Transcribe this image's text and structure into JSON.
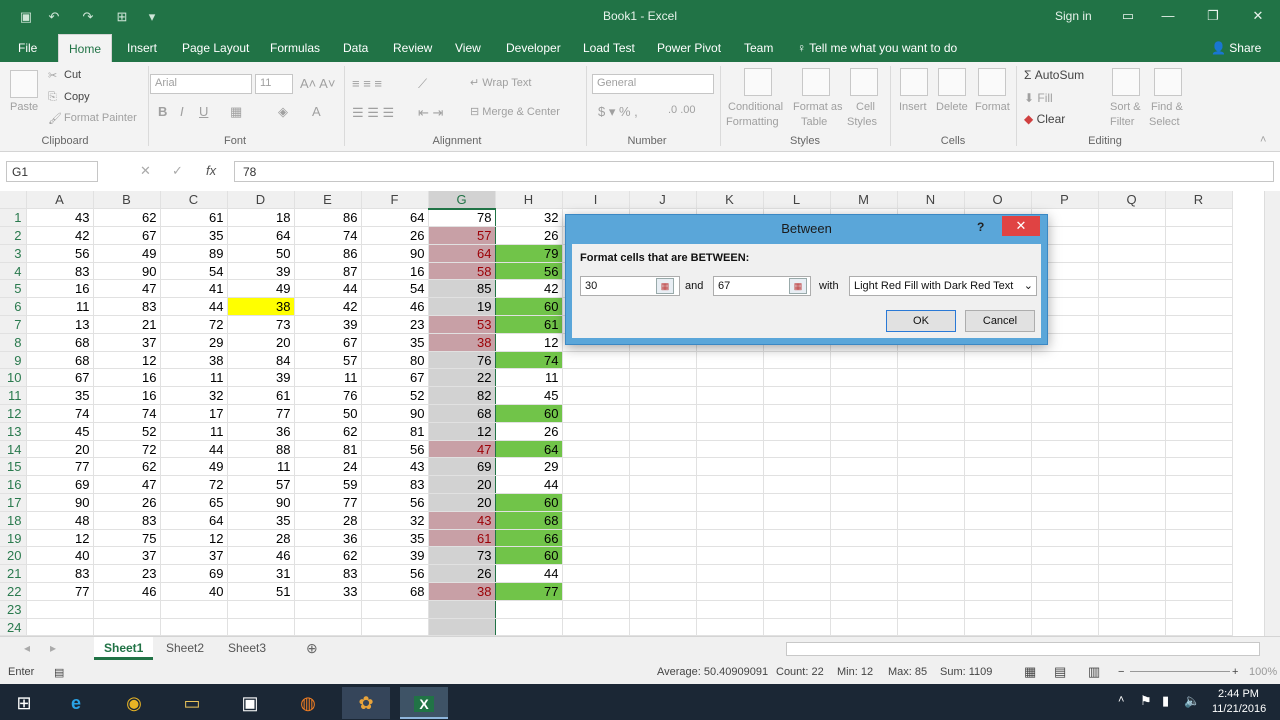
{
  "window": {
    "title": "Book1 - Excel",
    "sign_in": "Sign in"
  },
  "menu": {
    "tabs": [
      "File",
      "Home",
      "Insert",
      "Page Layout",
      "Formulas",
      "Data",
      "Review",
      "View",
      "Developer",
      "Load Test",
      "Power Pivot",
      "Team"
    ],
    "tell_me": "Tell me what you want to do",
    "share": "Share"
  },
  "ribbon": {
    "clipboard": {
      "paste": "Paste",
      "cut": "Cut",
      "copy": "Copy",
      "format_painter": "Format Painter",
      "label": "Clipboard"
    },
    "font": {
      "name": "Arial",
      "size": "11",
      "label": "Font"
    },
    "alignment": {
      "wrap_text": "Wrap Text",
      "merge_center": "Merge & Center",
      "label": "Alignment"
    },
    "number": {
      "format": "General",
      "label": "Number"
    },
    "styles": {
      "conditional": "Conditional",
      "formatting": "Formatting",
      "format_as": "Format as",
      "table": "Table",
      "cell": "Cell",
      "cell_styles": "Styles",
      "label": "Styles"
    },
    "cells": {
      "insert": "Insert",
      "delete": "Delete",
      "format": "Format",
      "label": "Cells"
    },
    "editing": {
      "autosum": "AutoSum",
      "fill": "Fill",
      "clear": "Clear",
      "sort": "Sort &",
      "filter": "Filter",
      "find": "Find &",
      "select": "Select",
      "label": "Editing"
    }
  },
  "formula_bar": {
    "name_box": "G1",
    "fx": "fx",
    "value": "78"
  },
  "grid": {
    "columns": [
      "A",
      "B",
      "C",
      "D",
      "E",
      "F",
      "G",
      "H",
      "I",
      "J",
      "K",
      "L",
      "M",
      "N",
      "O",
      "P",
      "Q",
      "R"
    ],
    "rows": [
      [
        43,
        62,
        61,
        18,
        86,
        64,
        78,
        32
      ],
      [
        42,
        67,
        35,
        64,
        74,
        26,
        57,
        26
      ],
      [
        56,
        49,
        89,
        50,
        86,
        90,
        64,
        79
      ],
      [
        83,
        90,
        54,
        39,
        87,
        16,
        58,
        56
      ],
      [
        16,
        47,
        41,
        49,
        44,
        54,
        85,
        42
      ],
      [
        11,
        83,
        44,
        38,
        42,
        46,
        19,
        60
      ],
      [
        13,
        21,
        72,
        73,
        39,
        23,
        53,
        61
      ],
      [
        68,
        37,
        29,
        20,
        67,
        35,
        38,
        12
      ],
      [
        68,
        12,
        38,
        84,
        57,
        80,
        76,
        74
      ],
      [
        67,
        16,
        11,
        39,
        11,
        67,
        22,
        11
      ],
      [
        35,
        16,
        32,
        61,
        76,
        52,
        82,
        45
      ],
      [
        74,
        74,
        17,
        77,
        50,
        90,
        68,
        60
      ],
      [
        45,
        52,
        11,
        36,
        62,
        81,
        12,
        26
      ],
      [
        20,
        72,
        44,
        88,
        81,
        56,
        47,
        64
      ],
      [
        77,
        62,
        49,
        11,
        24,
        43,
        69,
        29
      ],
      [
        69,
        47,
        72,
        57,
        59,
        83,
        20,
        44
      ],
      [
        90,
        26,
        65,
        90,
        77,
        56,
        20,
        60
      ],
      [
        48,
        83,
        64,
        35,
        28,
        32,
        43,
        68
      ],
      [
        12,
        75,
        12,
        28,
        36,
        35,
        61,
        66
      ],
      [
        40,
        37,
        37,
        46,
        62,
        39,
        73,
        60
      ],
      [
        83,
        23,
        69,
        31,
        83,
        56,
        26,
        44
      ],
      [
        77,
        46,
        40,
        51,
        33,
        68,
        38,
        77
      ]
    ],
    "row_count": 24,
    "g_red_rows": [
      2,
      3,
      4,
      7,
      8,
      14,
      18,
      19,
      22
    ],
    "h_green_rows": [
      3,
      4,
      6,
      7,
      9,
      12,
      14,
      17,
      18,
      19,
      20,
      22
    ],
    "yellow_cell": "D6"
  },
  "sheets": [
    "Sheet1",
    "Sheet2",
    "Sheet3"
  ],
  "status": {
    "mode": "Enter",
    "average": "Average: 50.40909091",
    "count": "Count: 22",
    "min": "Min: 12",
    "max": "Max: 85",
    "sum": "Sum: 1109",
    "zoom": "100%"
  },
  "dialog": {
    "title": "Between",
    "help": "?",
    "prompt": "Format cells that are BETWEEN:",
    "value1": "30",
    "and": "and",
    "value2": "67",
    "with": "with",
    "format_option": "Light Red Fill with Dark Red Text",
    "ok": "OK",
    "cancel": "Cancel"
  },
  "taskbar": {
    "time": "2:44 PM",
    "date": "11/21/2016"
  },
  "colors": {
    "excel_green": "#217346",
    "red_fill": "#c8a0a6",
    "red_text": "#9c0006",
    "green_fill": "#71c449",
    "yellow": "#ffff00",
    "dialog_blue": "#5aa6d9"
  }
}
